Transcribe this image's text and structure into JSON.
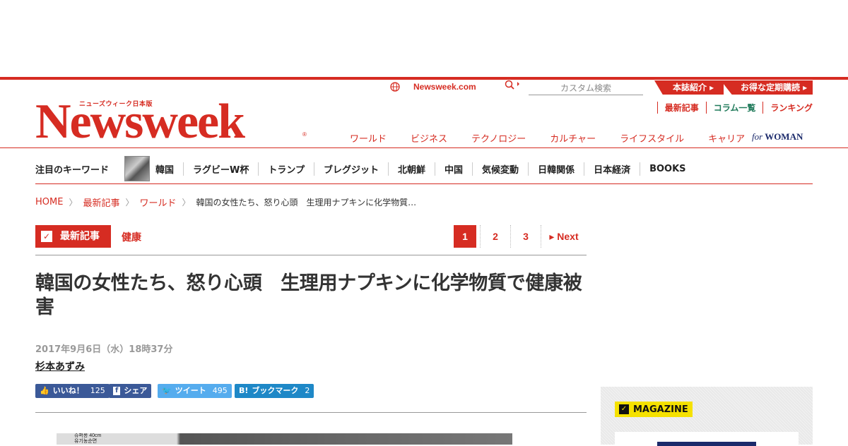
{
  "site": {
    "sub_title": "ニューズウィーク日本版",
    "logo_text": "Newsweek",
    "reg_mark": "®",
    "site_link": "Newsweek.com",
    "search_placeholder": "カスタム検索",
    "tabs": [
      "本誌紹介 ▸",
      "お得な定期購読 ▸"
    ],
    "links": [
      "最新記事",
      "コラム一覧",
      "ランキング"
    ],
    "main_nav": [
      "ワールド",
      "ビジネス",
      "テクノロジー",
      "カルチャー",
      "ライフスタイル",
      "キャリア"
    ],
    "for_woman": {
      "for": "for",
      "woman": "WOMAN"
    }
  },
  "keywords": {
    "title": "注目のキーワード",
    "items": [
      "韓国",
      "ラグビーW杯",
      "トランプ",
      "ブレグジット",
      "北朝鮮",
      "中国",
      "気候変動",
      "日韓関係",
      "日本経済",
      "BOOKS"
    ]
  },
  "breadcrumb": {
    "items": [
      "HOME",
      "最新記事",
      "ワールド"
    ],
    "current": "韓国の女性たち、怒り心頭　生理用ナプキンに化学物質…"
  },
  "category": {
    "label": "最新記事",
    "sub": "健康",
    "pages": [
      "1",
      "2",
      "3"
    ],
    "next": "▸ Next"
  },
  "article": {
    "headline": "韓国の女性たち、怒り心頭　生理用ナプキンに化学物質で健康被害",
    "date": "2017年9月6日（水）18時37分",
    "author": "杉本あずみ",
    "image_text": "슈퍼롱 40cm\n유기농순면"
  },
  "share": [
    {
      "label": "いいね！",
      "count": "125",
      "icon": "thumbs-up-icon"
    },
    {
      "label": "シェア",
      "count": "",
      "icon": "facebook-icon"
    },
    {
      "label": "ツイート",
      "count": "495",
      "icon": "twitter-icon"
    },
    {
      "label": "ブックマーク",
      "count": "2",
      "icon": "hatena-icon"
    }
  ],
  "sidebar": {
    "magazine_label": "MAGAZINE"
  },
  "colors": {
    "brand_red": "#d62c22",
    "magazine_yellow": "#f5e100"
  }
}
